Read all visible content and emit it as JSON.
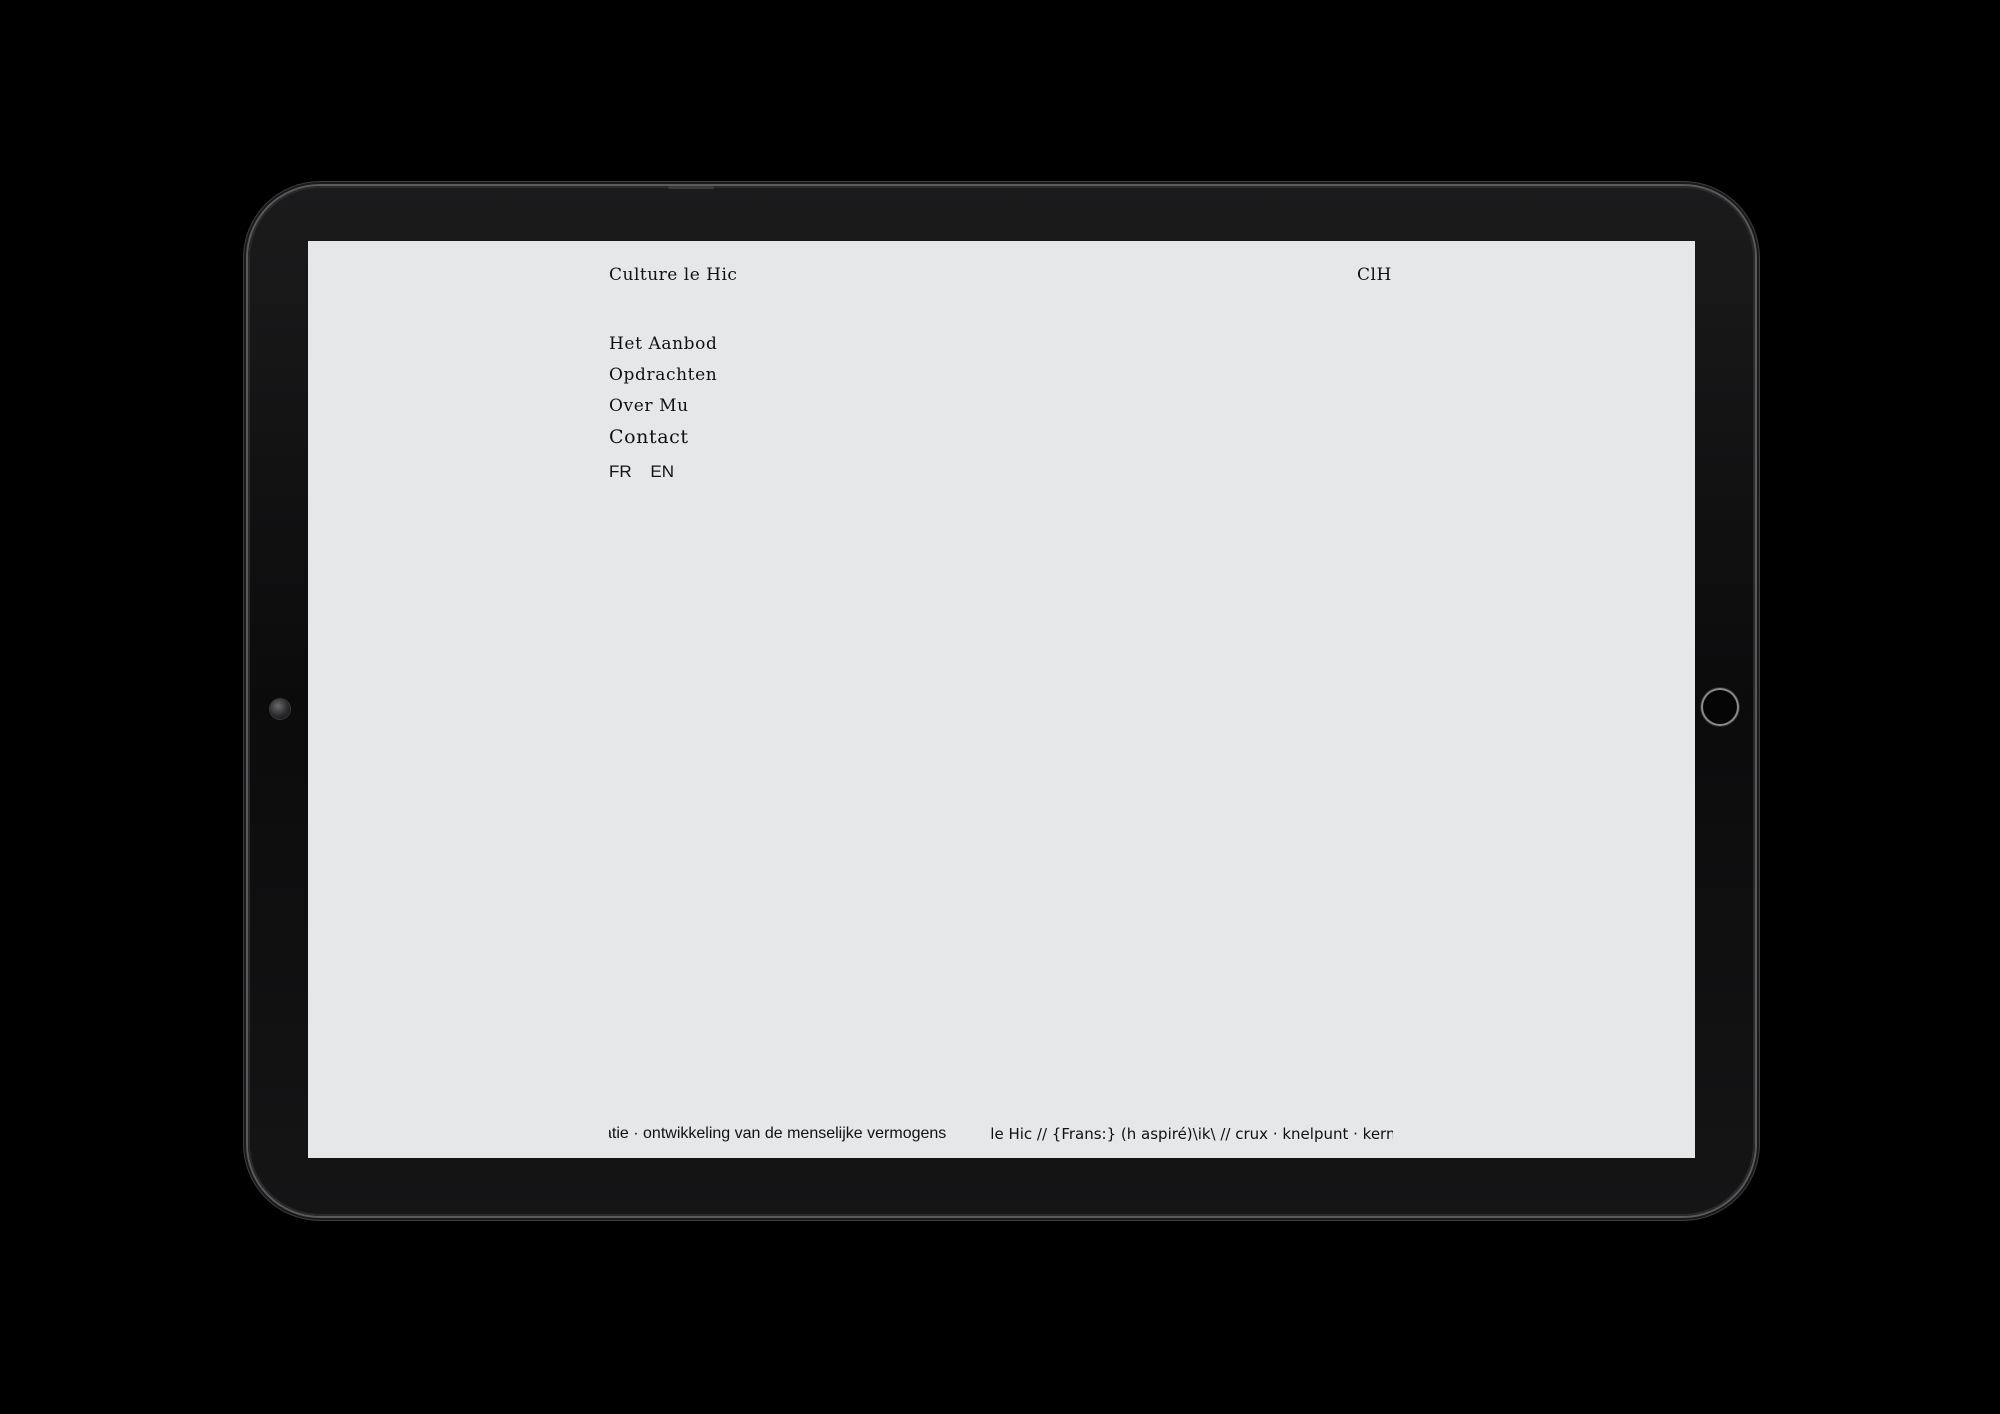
{
  "site": {
    "title": "Culture le Hic",
    "logo": "ClH"
  },
  "nav": {
    "items": [
      {
        "label": "Het Aanbod"
      },
      {
        "label": "Opdrachten"
      },
      {
        "label": "Over Mu"
      },
      {
        "label": "Contact"
      }
    ]
  },
  "languages": {
    "items": [
      "FR",
      "EN"
    ]
  },
  "ticker": {
    "segment_a": "atie · ontwikkeling van de menselijke vermogens",
    "segment_b": "le Hic // {Frans:} (h aspiré)\\ik\\ // crux · knelpunt · kern"
  },
  "colors": {
    "background": "#000000",
    "screen": "#e6e7e9",
    "text": "#111111"
  }
}
